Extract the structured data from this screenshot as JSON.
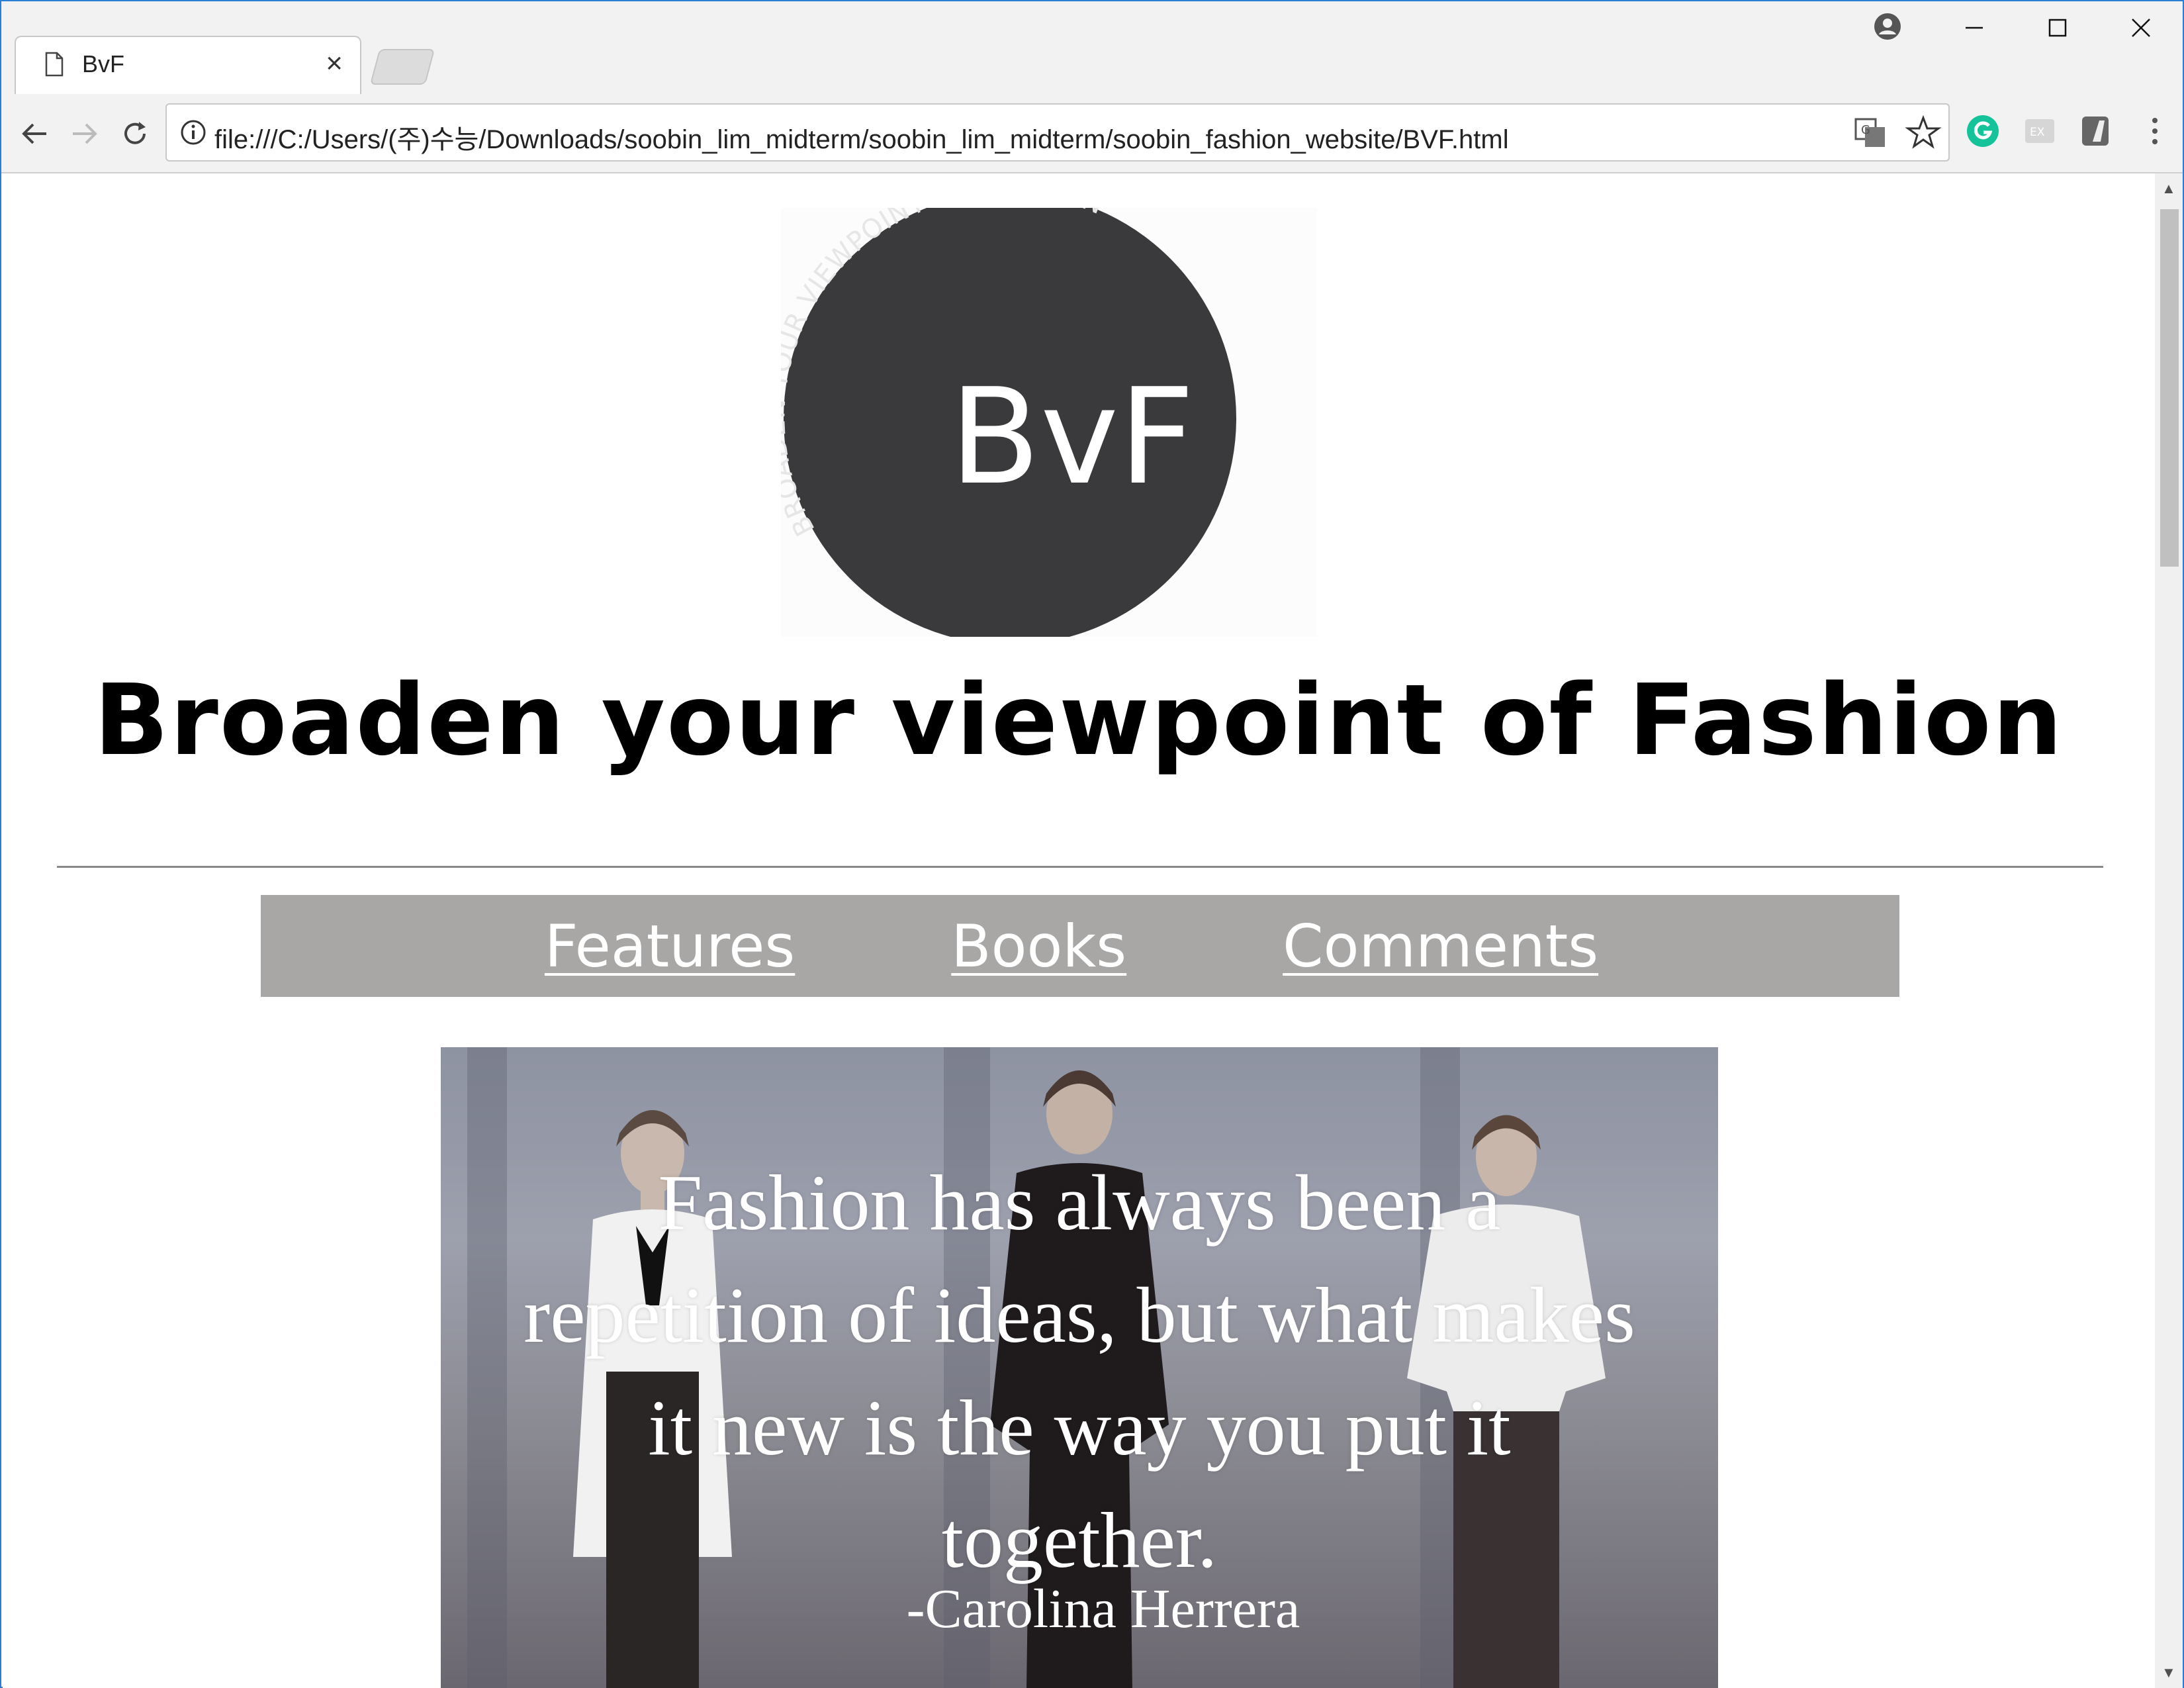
{
  "browser": {
    "tab_title": "BvF",
    "tab_close": "×",
    "url": "file:///C:/Users/(주)수능/Downloads/soobin_lim_midterm/soobin_lim_midterm/soobin_fashion_website/BVF.html"
  },
  "logo": {
    "monogram": "BvF",
    "arc_text": "BROADEN YOUR VIEWPOINT OF FASHION",
    "circle_color": "#3a3a3c"
  },
  "page": {
    "headline": "Broaden your viewpoint of Fashion",
    "nav": [
      "Features",
      "Books",
      "Comments"
    ],
    "nav_bg": "#a9a7a5"
  },
  "hero": {
    "quote_lines": [
      "Fashion has always been a",
      "repetition of ideas, but what makes",
      "it new is the way you put it",
      "together."
    ],
    "author": "-Carolina Herrera"
  },
  "icons": {
    "back": "arrow-left-icon",
    "forward": "arrow-right-icon",
    "reload": "reload-icon",
    "info": "info-icon",
    "translate": "translate-icon",
    "bookmark": "star-icon",
    "grammarly": "grammarly-icon",
    "ex_extension": "ex-extension-icon",
    "extension": "extension-icon",
    "menu": "kebab-menu-icon",
    "account": "account-icon"
  }
}
